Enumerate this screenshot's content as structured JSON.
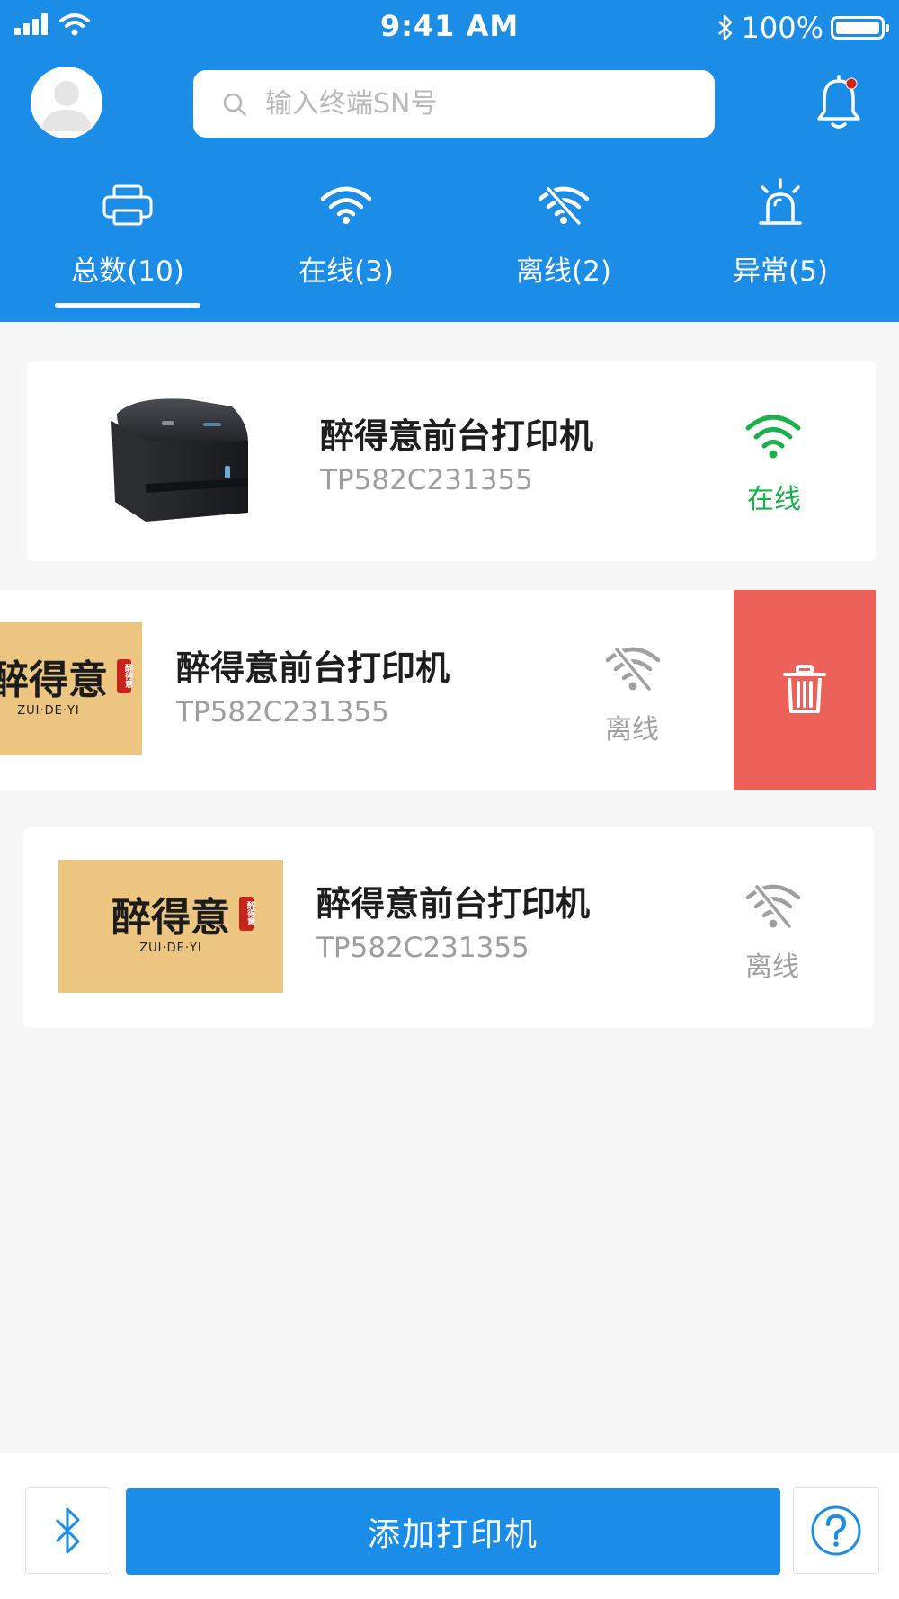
{
  "status_bar": {
    "time": "9:41 AM",
    "battery": "100%",
    "icons": [
      "signal-icon",
      "wifi-icon",
      "bluetooth-icon",
      "battery-icon"
    ]
  },
  "header": {
    "search": {
      "placeholder": "输入终端SN号",
      "value": ""
    },
    "has_notification": true
  },
  "tabs": [
    {
      "label": "总数(10)",
      "icon": "printer-icon",
      "active": true
    },
    {
      "label": "在线(3)",
      "icon": "wifi-icon",
      "active": false
    },
    {
      "label": "离线(2)",
      "icon": "wifi-off-icon",
      "active": false
    },
    {
      "label": "异常(5)",
      "icon": "alarm-icon",
      "active": false
    }
  ],
  "printers": [
    {
      "name": "醉得意前台打印机",
      "sn": "TP582C231355",
      "status": "在线",
      "image": "printer-photo",
      "status_color": "#19b14b"
    },
    {
      "name": "醉得意前台打印机",
      "sn": "TP582C231355",
      "status": "离线",
      "image": "brand-logo",
      "status_color": "#a0a0a0",
      "swiped": true
    },
    {
      "name": "醉得意前台打印机",
      "sn": "TP582C231355",
      "status": "离线",
      "image": "brand-logo",
      "status_color": "#a0a0a0"
    }
  ],
  "logo": {
    "text": "醉得意",
    "sub": "ZUI·DE·YI",
    "seal": "醉得意"
  },
  "footer": {
    "add_label": "添加打印机"
  },
  "colors": {
    "primary": "#1b8de6",
    "online": "#19b14b",
    "offline": "#a0a0a0",
    "delete": "#ec625b",
    "logo_bg": "#ecc680"
  }
}
